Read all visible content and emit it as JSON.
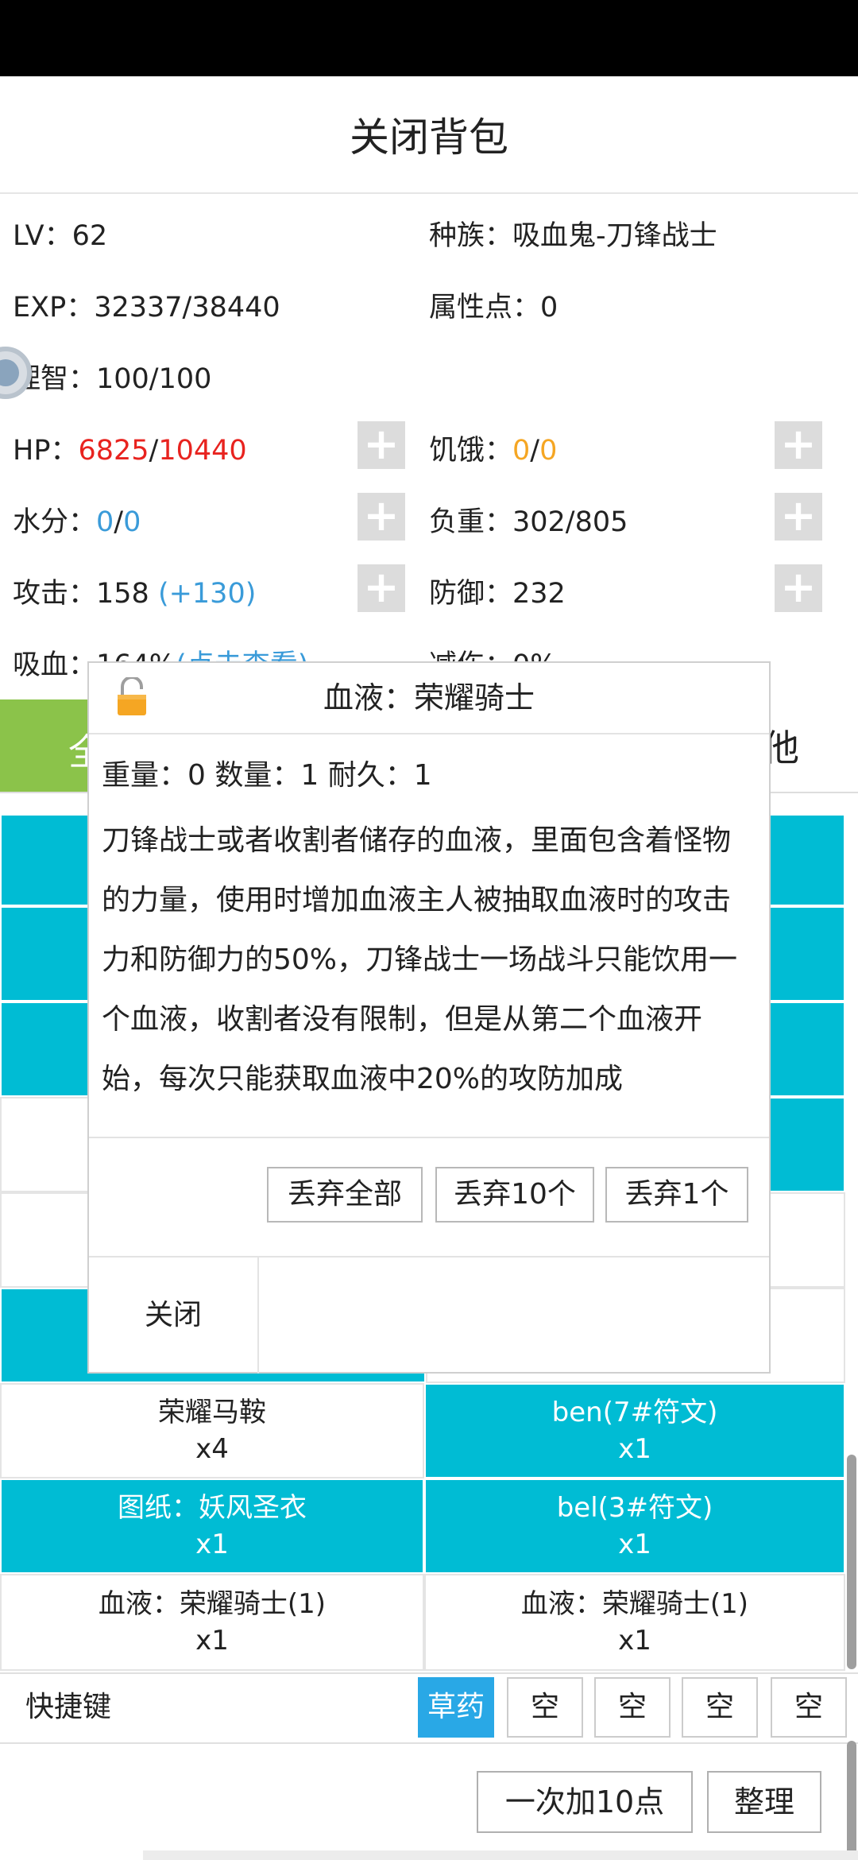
{
  "header": {
    "title": "关闭背包"
  },
  "stats": {
    "lv": "LV：62",
    "race": "种族：吸血鬼-刀锋战士",
    "exp": "EXP：32337/38440",
    "attr_points": "属性点：0",
    "sanity": "理智：100/100",
    "hp_label": "HP：",
    "hp_cur": "6825",
    "hp_sep": "/",
    "hp_max": "10440",
    "hunger_label": "饥饿：",
    "hunger_cur": "0",
    "hunger_sep": "/",
    "hunger_max": "0",
    "water_label": "水分：",
    "water_cur": "0",
    "water_sep": "/",
    "water_max": "0",
    "load": "负重：302/805",
    "attack_label": "攻击：158 ",
    "attack_bonus": "(+130)",
    "defense": "防御：232",
    "vamp_partial": "吸血：164%",
    "vamp_link": "(点击查看)",
    "reduce_partial": "减伤：0%",
    "plus_label": "+"
  },
  "tabs": {
    "left_partial": "全",
    "right_partial": "他"
  },
  "items": [
    {
      "name": "荣耀马鞍",
      "qty": "x4"
    },
    {
      "name": "ben(7#符文)",
      "qty": "x1"
    },
    {
      "name": "图纸：妖风圣衣",
      "qty": "x1"
    },
    {
      "name": "bel(3#符文)",
      "qty": "x1"
    },
    {
      "name": "血液：荣耀骑士(1)",
      "qty": "x1"
    },
    {
      "name": "血液：荣耀骑士(1)",
      "qty": "x1"
    }
  ],
  "shortcut": {
    "label": "快捷键",
    "slots": [
      "草药",
      "空",
      "空",
      "空",
      "空"
    ]
  },
  "bottom_buttons": {
    "add10": "一次加10点",
    "sort": "整理"
  },
  "dialog": {
    "title": "血液：荣耀骑士",
    "stats": "重量：0  数量：1  耐久：1",
    "description": "刀锋战士或者收割者储存的血液，里面包含着怪物的力量，使用时增加血液主人被抽取血液时的攻击力和防御力的50%，刀锋战士一场战斗只能饮用一个血液，收割者没有限制，但是从第二个血液开始，每次只能获取血液中20%的攻防加成",
    "btn_discard_all": "丢弃全部",
    "btn_discard_10": "丢弃10个",
    "btn_discard_1": "丢弃1个",
    "btn_close": "关闭"
  },
  "colors": {
    "cyan": "#00bcd4",
    "green": "#8bc34a",
    "red": "#e8231f",
    "orange": "#f5a623",
    "blue": "#3a9bd9",
    "shortcut_active": "#29a8e6"
  }
}
